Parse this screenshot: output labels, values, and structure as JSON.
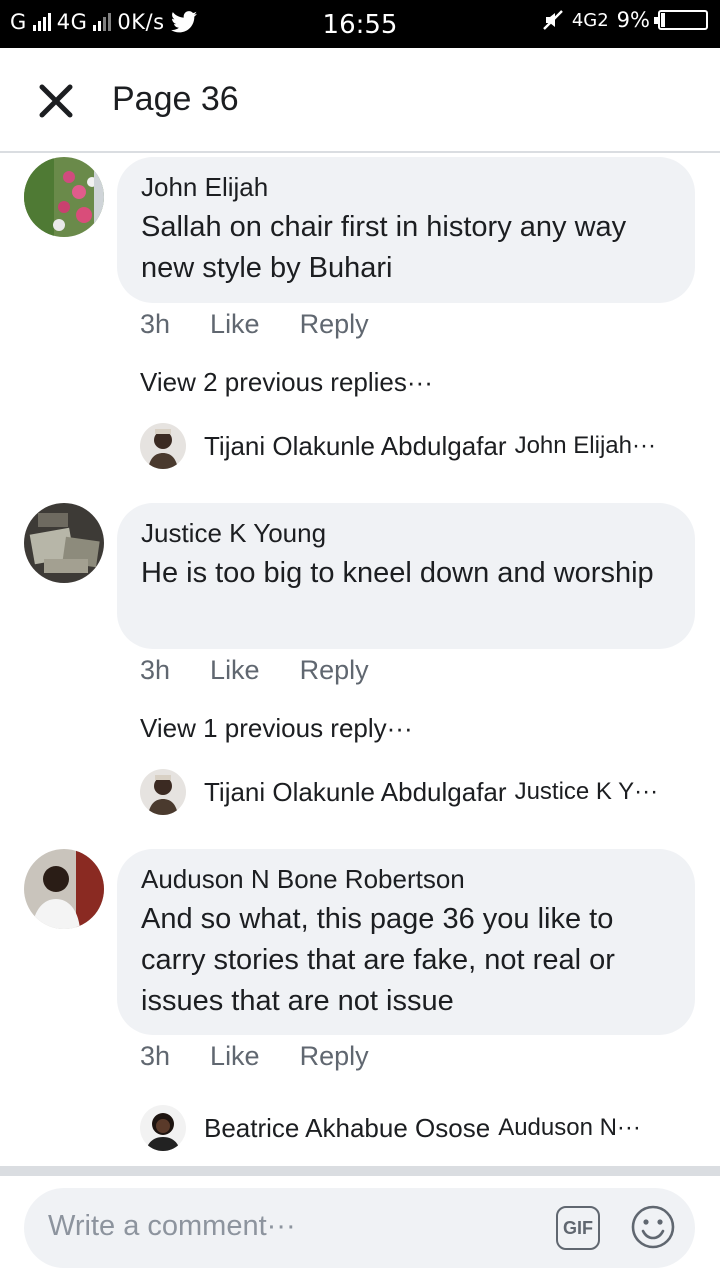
{
  "status_bar": {
    "carrier": "G",
    "network": "4G",
    "speed": "0K/s",
    "time": "16:55",
    "network_right": "4G2",
    "battery_percent": "9%",
    "battery_level": 0.09,
    "icons": [
      "signal-icon",
      "twitter-bird-icon",
      "mute-icon",
      "battery-icon"
    ]
  },
  "header": {
    "close_icon": "close-icon",
    "title": "Page 36"
  },
  "comments": [
    {
      "author": "John Elijah",
      "text": "Sallah on chair first in history any way new style by Buhari",
      "time": "3h",
      "like": "Like",
      "reply": "Reply",
      "view_replies": "View 2 previous replies···",
      "reply_preview": {
        "name": "Tijani Olakunle Abdulgafar",
        "snippet": "John Elijah···"
      }
    },
    {
      "author": "Justice K Young",
      "text": "He is too big to kneel down and worship",
      "time": "3h",
      "like": "Like",
      "reply": "Reply",
      "view_replies": "View 1 previous reply···",
      "reply_preview": {
        "name": "Tijani Olakunle Abdulgafar",
        "snippet": "Justice K Y···"
      }
    },
    {
      "author": "Auduson N Bone Robertson",
      "text": "And so what, this page 36 you like to carry stories that are fake, not real or issues that are not issue",
      "time": "3h",
      "like": "Like",
      "reply": "Reply",
      "reply_preview": {
        "name": "Beatrice Akhabue Osose",
        "snippet": "Auduson N···"
      }
    }
  ],
  "composer": {
    "placeholder": "Write a comment···",
    "gif_label": "GIF",
    "emoji_icon": "smiley-icon"
  },
  "colors": {
    "bubble": "#f0f2f5",
    "meta_text": "#606770",
    "placeholder": "#8d949e"
  }
}
